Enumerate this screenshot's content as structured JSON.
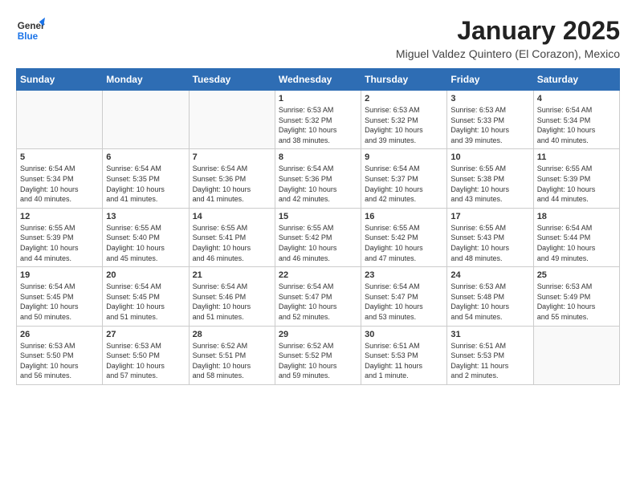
{
  "header": {
    "logo_line1": "General",
    "logo_line2": "Blue",
    "title": "January 2025",
    "subtitle": "Miguel Valdez Quintero (El Corazon), Mexico"
  },
  "days_of_week": [
    "Sunday",
    "Monday",
    "Tuesday",
    "Wednesday",
    "Thursday",
    "Friday",
    "Saturday"
  ],
  "weeks": [
    [
      {
        "day": "",
        "content": ""
      },
      {
        "day": "",
        "content": ""
      },
      {
        "day": "",
        "content": ""
      },
      {
        "day": "1",
        "content": "Sunrise: 6:53 AM\nSunset: 5:32 PM\nDaylight: 10 hours\nand 38 minutes."
      },
      {
        "day": "2",
        "content": "Sunrise: 6:53 AM\nSunset: 5:32 PM\nDaylight: 10 hours\nand 39 minutes."
      },
      {
        "day": "3",
        "content": "Sunrise: 6:53 AM\nSunset: 5:33 PM\nDaylight: 10 hours\nand 39 minutes."
      },
      {
        "day": "4",
        "content": "Sunrise: 6:54 AM\nSunset: 5:34 PM\nDaylight: 10 hours\nand 40 minutes."
      }
    ],
    [
      {
        "day": "5",
        "content": "Sunrise: 6:54 AM\nSunset: 5:34 PM\nDaylight: 10 hours\nand 40 minutes."
      },
      {
        "day": "6",
        "content": "Sunrise: 6:54 AM\nSunset: 5:35 PM\nDaylight: 10 hours\nand 41 minutes."
      },
      {
        "day": "7",
        "content": "Sunrise: 6:54 AM\nSunset: 5:36 PM\nDaylight: 10 hours\nand 41 minutes."
      },
      {
        "day": "8",
        "content": "Sunrise: 6:54 AM\nSunset: 5:36 PM\nDaylight: 10 hours\nand 42 minutes."
      },
      {
        "day": "9",
        "content": "Sunrise: 6:54 AM\nSunset: 5:37 PM\nDaylight: 10 hours\nand 42 minutes."
      },
      {
        "day": "10",
        "content": "Sunrise: 6:55 AM\nSunset: 5:38 PM\nDaylight: 10 hours\nand 43 minutes."
      },
      {
        "day": "11",
        "content": "Sunrise: 6:55 AM\nSunset: 5:39 PM\nDaylight: 10 hours\nand 44 minutes."
      }
    ],
    [
      {
        "day": "12",
        "content": "Sunrise: 6:55 AM\nSunset: 5:39 PM\nDaylight: 10 hours\nand 44 minutes."
      },
      {
        "day": "13",
        "content": "Sunrise: 6:55 AM\nSunset: 5:40 PM\nDaylight: 10 hours\nand 45 minutes."
      },
      {
        "day": "14",
        "content": "Sunrise: 6:55 AM\nSunset: 5:41 PM\nDaylight: 10 hours\nand 46 minutes."
      },
      {
        "day": "15",
        "content": "Sunrise: 6:55 AM\nSunset: 5:42 PM\nDaylight: 10 hours\nand 46 minutes."
      },
      {
        "day": "16",
        "content": "Sunrise: 6:55 AM\nSunset: 5:42 PM\nDaylight: 10 hours\nand 47 minutes."
      },
      {
        "day": "17",
        "content": "Sunrise: 6:55 AM\nSunset: 5:43 PM\nDaylight: 10 hours\nand 48 minutes."
      },
      {
        "day": "18",
        "content": "Sunrise: 6:54 AM\nSunset: 5:44 PM\nDaylight: 10 hours\nand 49 minutes."
      }
    ],
    [
      {
        "day": "19",
        "content": "Sunrise: 6:54 AM\nSunset: 5:45 PM\nDaylight: 10 hours\nand 50 minutes."
      },
      {
        "day": "20",
        "content": "Sunrise: 6:54 AM\nSunset: 5:45 PM\nDaylight: 10 hours\nand 51 minutes."
      },
      {
        "day": "21",
        "content": "Sunrise: 6:54 AM\nSunset: 5:46 PM\nDaylight: 10 hours\nand 51 minutes."
      },
      {
        "day": "22",
        "content": "Sunrise: 6:54 AM\nSunset: 5:47 PM\nDaylight: 10 hours\nand 52 minutes."
      },
      {
        "day": "23",
        "content": "Sunrise: 6:54 AM\nSunset: 5:47 PM\nDaylight: 10 hours\nand 53 minutes."
      },
      {
        "day": "24",
        "content": "Sunrise: 6:53 AM\nSunset: 5:48 PM\nDaylight: 10 hours\nand 54 minutes."
      },
      {
        "day": "25",
        "content": "Sunrise: 6:53 AM\nSunset: 5:49 PM\nDaylight: 10 hours\nand 55 minutes."
      }
    ],
    [
      {
        "day": "26",
        "content": "Sunrise: 6:53 AM\nSunset: 5:50 PM\nDaylight: 10 hours\nand 56 minutes."
      },
      {
        "day": "27",
        "content": "Sunrise: 6:53 AM\nSunset: 5:50 PM\nDaylight: 10 hours\nand 57 minutes."
      },
      {
        "day": "28",
        "content": "Sunrise: 6:52 AM\nSunset: 5:51 PM\nDaylight: 10 hours\nand 58 minutes."
      },
      {
        "day": "29",
        "content": "Sunrise: 6:52 AM\nSunset: 5:52 PM\nDaylight: 10 hours\nand 59 minutes."
      },
      {
        "day": "30",
        "content": "Sunrise: 6:51 AM\nSunset: 5:53 PM\nDaylight: 11 hours\nand 1 minute."
      },
      {
        "day": "31",
        "content": "Sunrise: 6:51 AM\nSunset: 5:53 PM\nDaylight: 11 hours\nand 2 minutes."
      },
      {
        "day": "",
        "content": ""
      }
    ]
  ]
}
